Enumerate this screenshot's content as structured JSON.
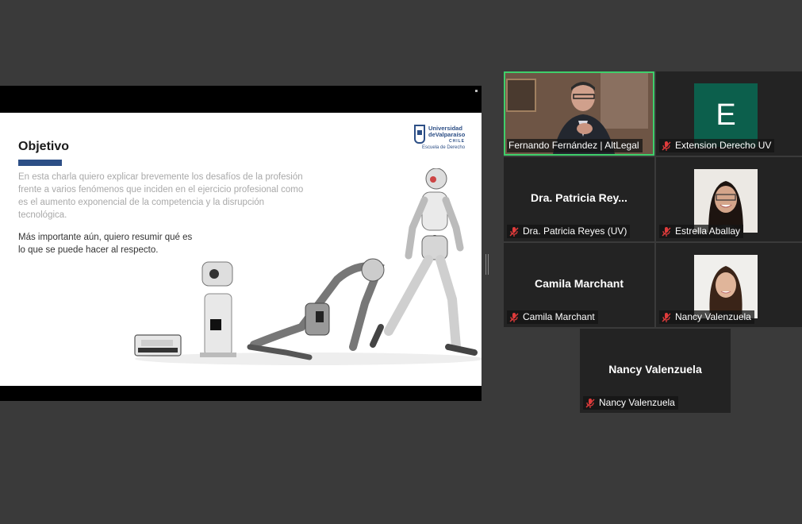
{
  "slide": {
    "title": "Objetivo",
    "paragraph1": "En esta charla quiero explicar brevemente los desafíos de la profesión frente a varios fenómenos que inciden en el ejercicio profesional como es el aumento exponencial de la competencia y la disrupción tecnológica.",
    "paragraph2": "Más importante aún, quiero resumir qué es lo que se puede hacer al respecto.",
    "logo": {
      "line1": "Universidad",
      "line2": "deValparaíso",
      "line3": "CHILE",
      "line4": "Escuela de Derecho"
    },
    "accent_color": "#2d4f86"
  },
  "participants": [
    {
      "label": "Fernando Fernández | AltLegal",
      "type": "video",
      "speaking": true
    },
    {
      "label": "Extension Derecho UV",
      "type": "avatar",
      "initial": "E",
      "muted": true
    },
    {
      "label": "Dra. Patricia Reyes (UV)",
      "big_name": "Dra. Patricia Rey...",
      "type": "name",
      "muted": true
    },
    {
      "label": "Estrella Aballay",
      "type": "photo",
      "muted": true
    },
    {
      "label": "Camila Marchant",
      "big_name": "Camila Marchant",
      "type": "name",
      "muted": true
    },
    {
      "label": "Nancy Valenzuela",
      "type": "photo",
      "muted": true
    },
    {
      "label": "Nancy Valenzuela",
      "big_name": "Nancy Valenzuela",
      "type": "name",
      "muted": true
    }
  ],
  "icons": {
    "muted": "mic-muted-icon"
  },
  "colors": {
    "speaking_border": "#3fcf6b",
    "avatar_bg": "#0c5f4c",
    "muted_red": "#e03b3b"
  }
}
